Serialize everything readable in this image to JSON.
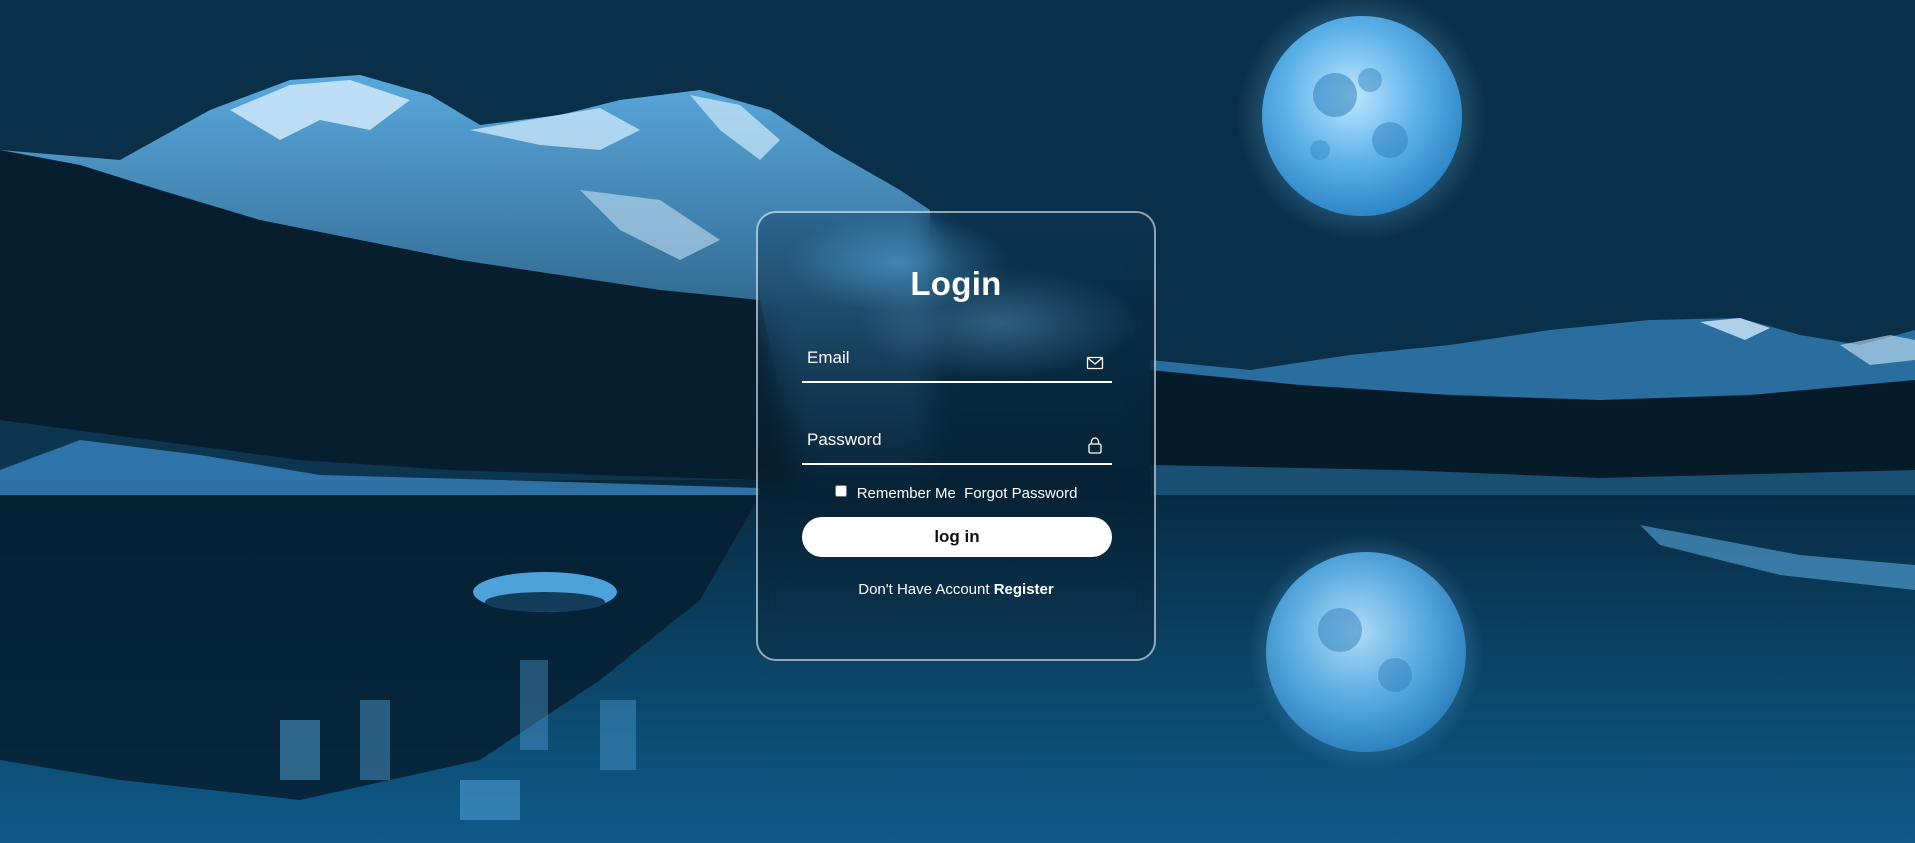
{
  "background": {
    "scene": "night-mountain-lake-with-full-moon",
    "accent_color": "#4aa8e8",
    "sky_color": "#0b3550",
    "water_color": "#0d4d74"
  },
  "login_form": {
    "title": "Login",
    "email": {
      "placeholder": "Email",
      "value": "",
      "icon": "mail-icon"
    },
    "password": {
      "placeholder": "Password",
      "value": "",
      "icon": "lock-icon"
    },
    "remember_me_label": "Remember Me",
    "remember_me_checked": false,
    "forgot_password_label": "Forgot Password",
    "submit_label": "log in",
    "register_prompt": "Don't Have Account",
    "register_link_label": "Register"
  }
}
